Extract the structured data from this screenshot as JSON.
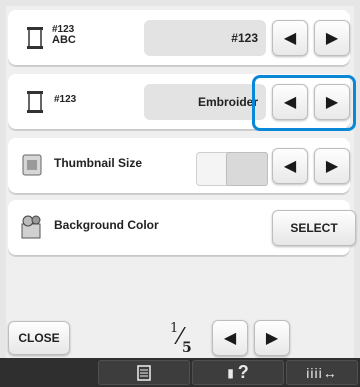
{
  "rows": {
    "thread_display": {
      "label_line1": "#123",
      "label_line2": "ABC",
      "value": "#123"
    },
    "thread_number": {
      "label": "#123",
      "value": "Embroider"
    },
    "thumbnail_size": {
      "label": "Thumbnail Size"
    },
    "background_color": {
      "label": "Background Color",
      "button": "SELECT"
    }
  },
  "footer": {
    "close": "CLOSE",
    "page_current": "1",
    "page_total": "5"
  },
  "bottom_bar": {
    "help_text": "?"
  },
  "colors": {
    "highlight": "#0a88d8",
    "bar": "#2f2f2f"
  }
}
